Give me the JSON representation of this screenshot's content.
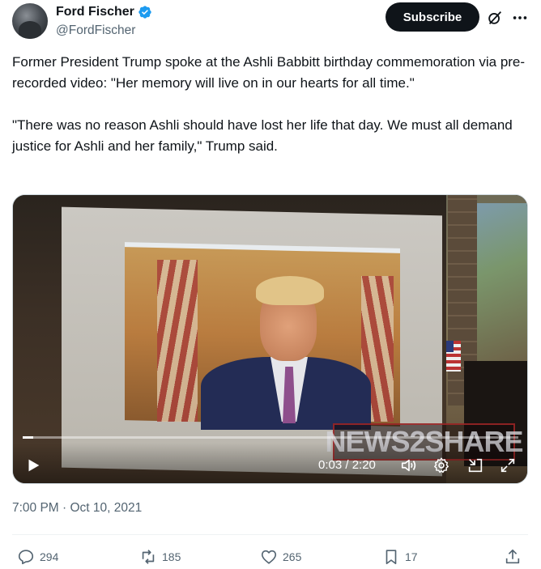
{
  "author": {
    "display_name": "Ford Fischer",
    "handle": "@FordFischer",
    "verified": true
  },
  "header": {
    "subscribe_label": "Subscribe",
    "icons": [
      "grok-icon",
      "more-icon"
    ]
  },
  "tweet": {
    "paragraphs": [
      "Former President Trump spoke at the Ashli Babbitt birthday commemoration via pre-recorded video: \"Her memory will live on in our hearts for all time.\"",
      "\"There was no reason Ashli should have lost her life that day. We must all demand justice for Ashli and her family,\" Trump said."
    ]
  },
  "video": {
    "watermark": "NEWS2SHARE",
    "time_display": "0:03 / 2:20",
    "progress": 0.021
  },
  "timestamp": "7:00 PM · Oct 10, 2021",
  "actions": {
    "replies": "294",
    "reposts": "185",
    "likes": "265",
    "bookmarks": "17"
  },
  "colors": {
    "text": "#0f1419",
    "secondary": "#536471",
    "verified_blue": "#1d9bf0",
    "subscribe_bg": "#0f1419"
  }
}
